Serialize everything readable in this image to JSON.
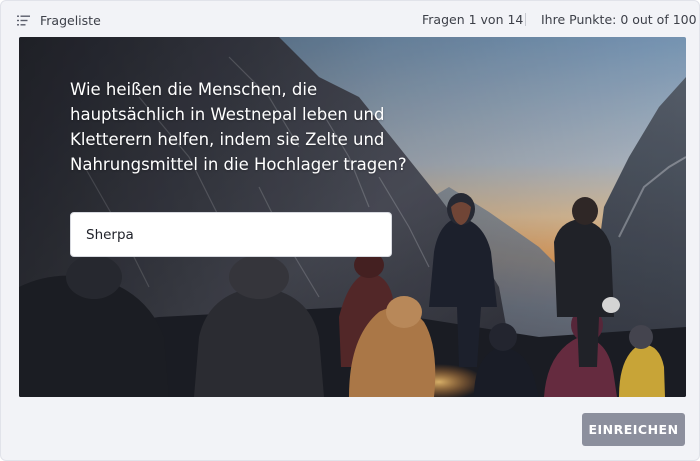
{
  "topbar": {
    "menu_icon": "list-icon",
    "menu_label": "Frageliste",
    "question_counter": "Fragen 1 von 14",
    "points": "Ihre Punkte: 0 out of 100"
  },
  "question": {
    "text": "Wie heißen die Menschen, die\nhauptsächlich in Westnepal leben und\nKletterern helfen, indem sie Zelte und\nNahrungsmittel in die Hochlager tragen?",
    "answer_value": "Sherpa"
  },
  "footer": {
    "submit_label": "EINREICHEN"
  },
  "colors": {
    "background": "#f2f3f7",
    "submit_button": "#8c8f9d",
    "text": "#3d4049"
  }
}
